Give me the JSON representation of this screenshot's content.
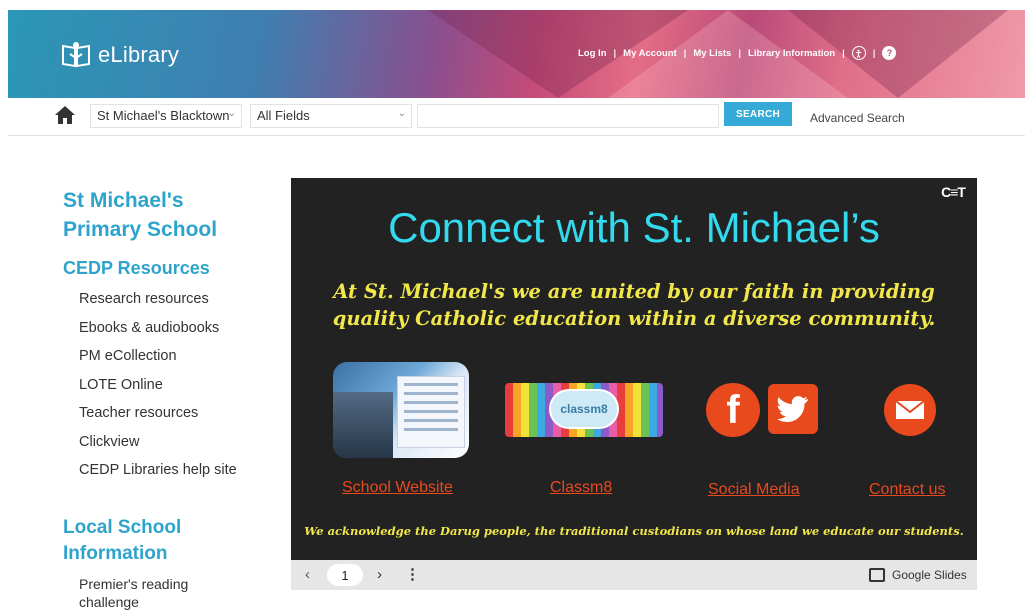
{
  "header": {
    "logo_text": "eLibrary",
    "links": [
      "Log In",
      "My Account",
      "My Lists",
      "Library Information"
    ],
    "accessibility_icon": "accessibility-icon",
    "help_icon": "help-icon",
    "help_glyph": "?"
  },
  "search": {
    "library_select": "St Michael's Blacktown",
    "field_select": "All Fields",
    "button_label": "SEARCH",
    "advanced_label": "Advanced Search",
    "home_icon": "home-icon"
  },
  "sidebar": {
    "school_title_line1": "St Michael's",
    "school_title_line2": "Primary School",
    "section_title": "CEDP Resources",
    "items": [
      "Research resources",
      "Ebooks & audiobooks",
      "PM eCollection",
      "LOTE Online",
      "Teacher resources",
      "Clickview",
      "CEDP Libraries help site"
    ],
    "local_title_line1": "Local School",
    "local_title_line2": "Information",
    "local_items": [
      "Premier's reading",
      "challenge"
    ]
  },
  "slide": {
    "title": "Connect with St. Michael’s",
    "tagline_line1": "At St. Michael's we are united by our faith in providing",
    "tagline_line2": "quality Catholic education within a diverse community.",
    "classm8_logo_text": "classm8",
    "links": [
      "School Website",
      "Classm8",
      "Social Media",
      "Contact us"
    ],
    "acknowledgement": "We acknowledge the Darug people, the traditional custodians on whose land we educate our students."
  },
  "slide_controls": {
    "page": "1",
    "prev_glyph": "‹",
    "next_glyph": "›",
    "more_glyph": "⋮",
    "google_slides_label": "Google Slides"
  },
  "colors": {
    "accent": "#2ea4cc",
    "search_button": "#35aad6",
    "slide_bg": "#222222",
    "slide_title": "#33d9ec",
    "slide_tagline": "#f1e74b",
    "slide_link": "#e8491d"
  }
}
